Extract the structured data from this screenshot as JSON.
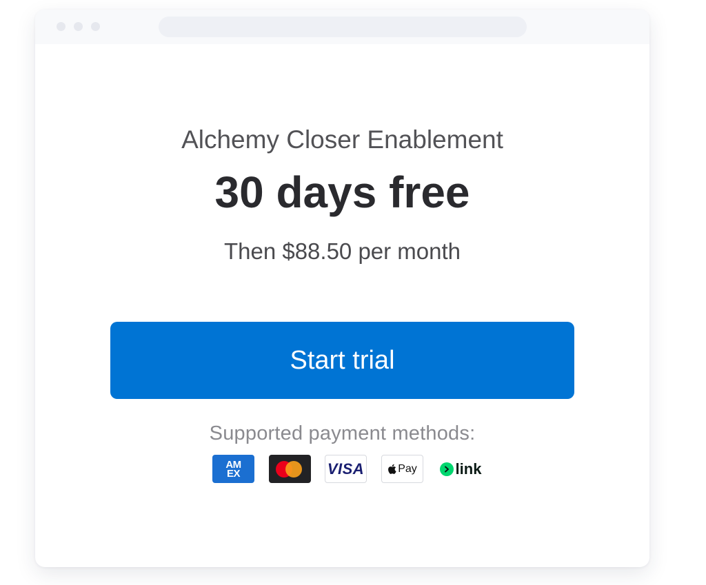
{
  "product": {
    "name": "Alchemy Closer Enablement",
    "headline": "30 days free",
    "price_line": "Then $88.50 per month"
  },
  "cta": {
    "label": "Start trial",
    "color": "#0074d4"
  },
  "payment_methods": {
    "label": "Supported payment methods:",
    "methods": [
      {
        "name": "American Express",
        "icon": "amex-icon",
        "text_top": "AM",
        "text_bottom": "EX"
      },
      {
        "name": "Mastercard",
        "icon": "mastercard-icon"
      },
      {
        "name": "Visa",
        "icon": "visa-icon",
        "text": "VISA"
      },
      {
        "name": "Apple Pay",
        "icon": "apple-pay-icon",
        "text": "Pay"
      },
      {
        "name": "Link",
        "icon": "link-icon",
        "text": "link"
      }
    ]
  }
}
